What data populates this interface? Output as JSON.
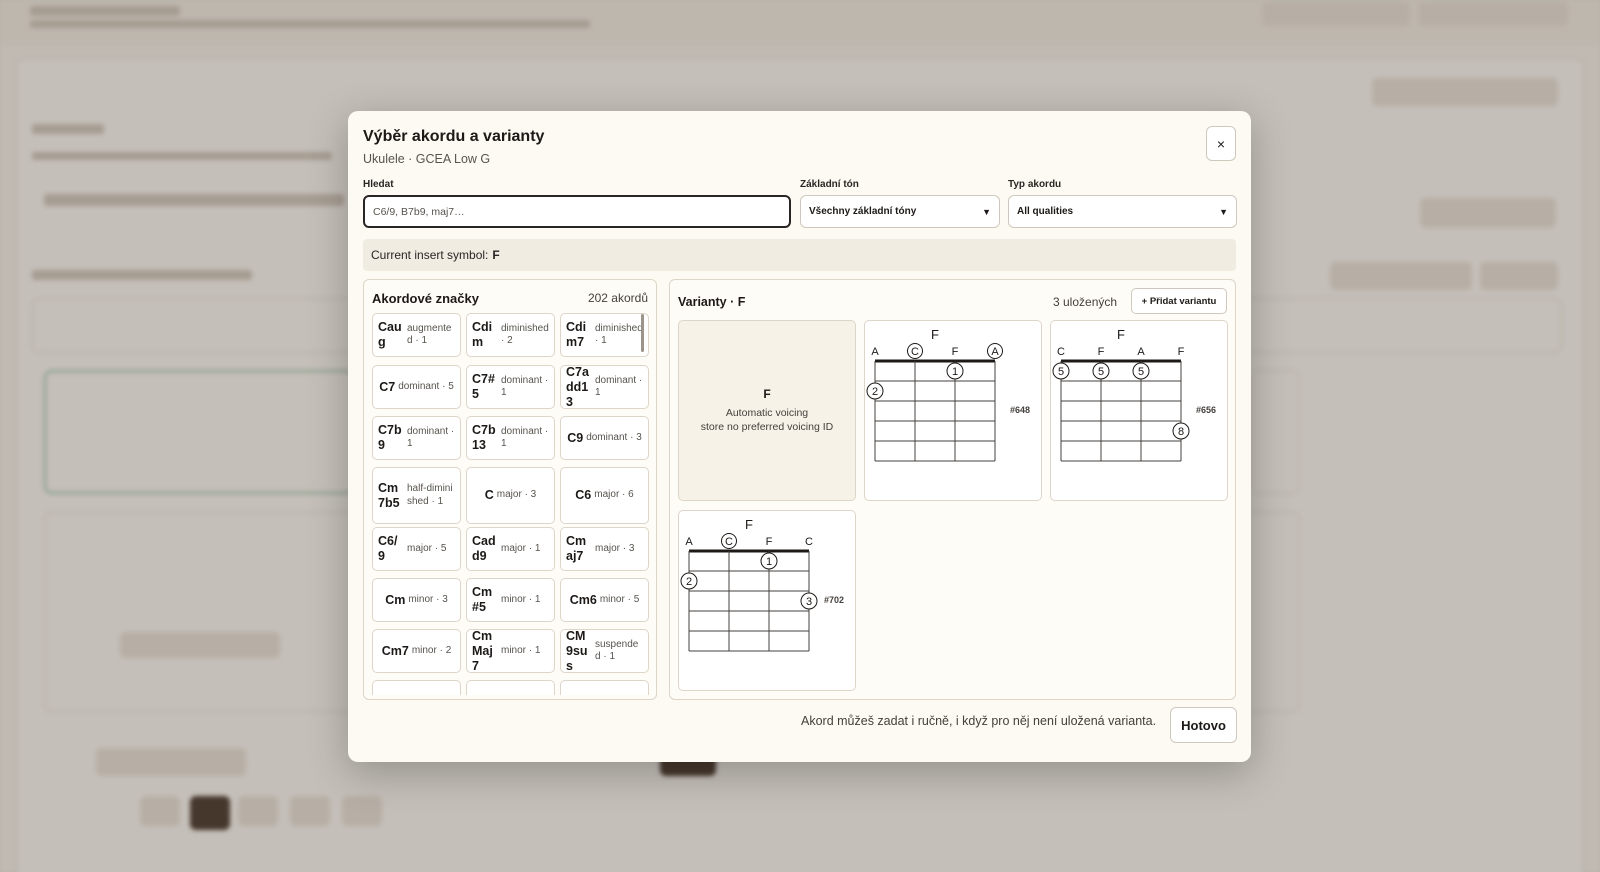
{
  "modal": {
    "title": "Výběr akordu a varianty",
    "subtitle": "Ukulele · GCEA Low G",
    "close_label": "×",
    "search": {
      "label": "Hledat",
      "placeholder": "C6/9, B7b9, maj7…",
      "value": ""
    },
    "root_select": {
      "label": "Základní tón",
      "value": "Všechny základní tóny"
    },
    "type_select": {
      "label": "Typ akordu",
      "value": "All qualities"
    },
    "insert": {
      "prefix": "Current insert symbol:",
      "symbol": "F"
    },
    "chord_list": {
      "title": "Akordové značky",
      "count": "202 akordů",
      "items": [
        {
          "name": "Caug",
          "quality": "augmented · 1"
        },
        {
          "name": "Cdim",
          "quality": "diminished · 2"
        },
        {
          "name": "Cdim7",
          "quality": "diminished · 1"
        },
        {
          "name": "C7",
          "quality": "dominant · 5"
        },
        {
          "name": "C7#5",
          "quality": "dominant · 1"
        },
        {
          "name": "C7add13",
          "quality": "dominant · 1"
        },
        {
          "name": "C7b9",
          "quality": "dominant · 1"
        },
        {
          "name": "C7b13",
          "quality": "dominant · 1"
        },
        {
          "name": "C9",
          "quality": "dominant · 3"
        },
        {
          "name": "Cm7b5",
          "quality": "half-diminished · 1"
        },
        {
          "name": "C",
          "quality": "major · 3"
        },
        {
          "name": "C6",
          "quality": "major · 6"
        },
        {
          "name": "C6/9",
          "quality": "major · 5"
        },
        {
          "name": "Cadd9",
          "quality": "major · 1"
        },
        {
          "name": "Cmaj7",
          "quality": "major · 3"
        },
        {
          "name": "Cm",
          "quality": "minor · 3"
        },
        {
          "name": "Cm#5",
          "quality": "minor · 1"
        },
        {
          "name": "Cm6",
          "quality": "minor · 5"
        },
        {
          "name": "Cm7",
          "quality": "minor · 2"
        },
        {
          "name": "CmMaj7",
          "quality": "minor · 1"
        },
        {
          "name": "CM9sus",
          "quality": "suspended · 1"
        }
      ]
    },
    "voicings": {
      "title": "Varianty · F",
      "saved": "3 uložených",
      "add_label": "+ Přidat variantu",
      "auto": {
        "name": "F",
        "line1": "Automatic voicing",
        "line2": "store no preferred voicing ID"
      },
      "cards": [
        {
          "chord": "F",
          "strings": [
            "A",
            "C",
            "F",
            "A"
          ],
          "circled_open": [
            false,
            true,
            false,
            true
          ],
          "id": "#648",
          "fingers": [
            {
              "string": 0,
              "fret": 2,
              "label": "2"
            },
            {
              "string": 2,
              "fret": 1,
              "label": "1"
            }
          ]
        },
        {
          "chord": "F",
          "strings": [
            "C",
            "F",
            "A",
            "F"
          ],
          "circled_open": [
            false,
            false,
            false,
            false
          ],
          "id": "#656",
          "fingers": [
            {
              "string": 0,
              "fret": 1,
              "label": "5"
            },
            {
              "string": 1,
              "fret": 1,
              "label": "5"
            },
            {
              "string": 2,
              "fret": 1,
              "label": "5"
            },
            {
              "string": 3,
              "fret": 4,
              "label": "8"
            }
          ]
        },
        {
          "chord": "F",
          "strings": [
            "A",
            "C",
            "F",
            "C"
          ],
          "circled_open": [
            false,
            true,
            false,
            false
          ],
          "id": "#702",
          "fingers": [
            {
              "string": 0,
              "fret": 2,
              "label": "2"
            },
            {
              "string": 2,
              "fret": 1,
              "label": "1"
            },
            {
              "string": 3,
              "fret": 3,
              "label": "3"
            }
          ]
        }
      ]
    },
    "footer": {
      "note": "Akord můžeš zadat i ručně, i když pro něj není uložená varianta.",
      "done_label": "Hotovo"
    }
  }
}
